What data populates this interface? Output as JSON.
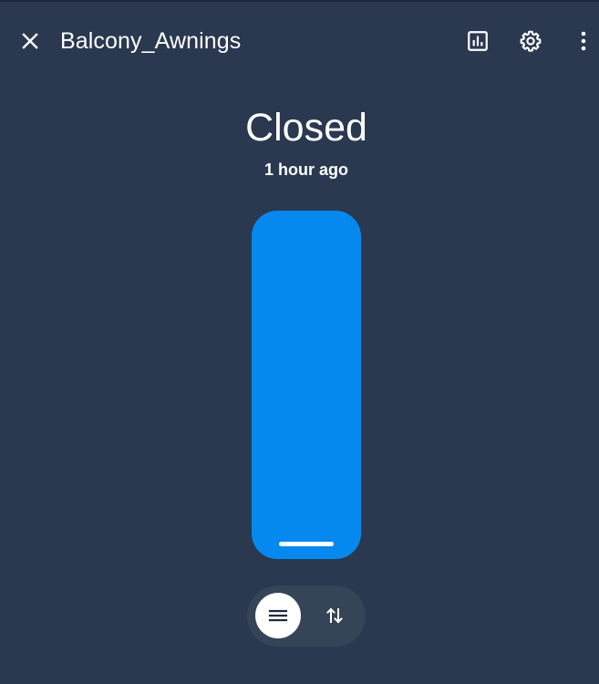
{
  "header": {
    "title": "Balcony_Awnings",
    "icons": {
      "close": "close-icon",
      "history": "chart-bar-icon",
      "settings": "gear-icon",
      "menu": "dots-vertical-icon"
    }
  },
  "cover": {
    "state": "Closed",
    "last_changed": "1 hour ago",
    "position_fraction": 1.0
  },
  "mode_toggle": {
    "options": [
      "position-slider",
      "open-close-buttons"
    ],
    "selected": "position-slider",
    "icons": {
      "position": "menu-lines-icon",
      "buttons": "swap-vertical-arrows-icon"
    }
  },
  "colors": {
    "background": "#2a3850",
    "slider_fill": "#0589ee",
    "toggle_background": "#364458",
    "text": "#ffffff"
  }
}
